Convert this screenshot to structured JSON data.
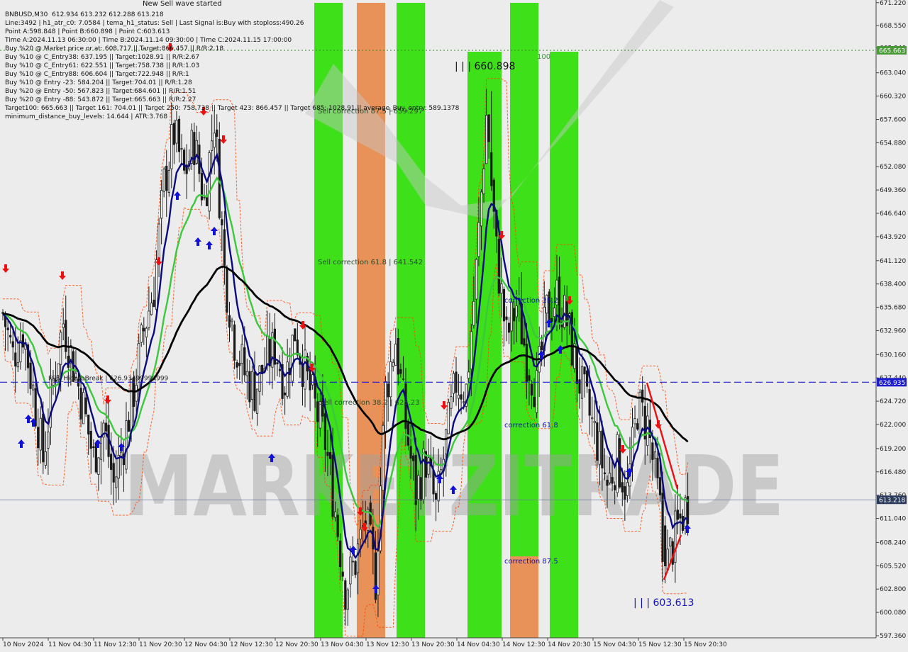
{
  "header": {
    "signal_line": "New Sell wave started",
    "lines": [
      "BNBUSD,M30  612.934 613.232 612.288 613.218",
      "Line:3492 | h1_atr_c0: 7.0584 | tema_h1_status: Sell | Last Signal is:Buy with stoploss:490.26",
      "Point A:598.848 | Point B:660.898 | Point C:603.613",
      "Time A:2024.11.13 06:30:00 | Time B:2024.11.14 09:30:00 | Time C:2024.11.15 17:00:00",
      "Buy %20 @ Market price or at: 608.717 || Target:866.457 || R/R:2.18",
      "Buy %10 @ C_Entry38: 637.195 || Target:1028.91 || R/R:2.67",
      "Buy %10 @ C_Entry61: 622.551 || Target:758.738 || R/R:1.03",
      "Buy %10 @ C_Entry88: 606.604 || Target:722.948 || R/R:1",
      "Buy %10 @ Entry -23: 584.204 || Target:704.01 || R/R:1.28",
      "Buy %20 @ Entry -50: 567.823 || Target:684.601 || R/R:1.51",
      "Buy %20 @ Entry -88: 543.872 || Target:665.663 || R/R:2.27",
      "Target100: 665.663 || Target 161: 704.01 || Target 250: 758.738 || Target 423: 866.457 || Target 685: 1028.91 || average_Buy_entry: 589.1378",
      "minimum_distance_buy_levels: 14.644 | ATR:3.768"
    ]
  },
  "annotations": {
    "point_b": "| | | 660.898",
    "point_c": "| | | 603.613",
    "sell_corr_875": "Sell correction 87.5 | 659.297",
    "sell_corr_618": "Sell correction 61.8 | 641.542",
    "sell_corr_382": "Sell correction 38.2 | 625.23",
    "corr_382": "correction 38.2",
    "corr_618": "correction 61.8",
    "corr_875": "correction 87.5",
    "level_100": "100",
    "fsb_label": "FSB_HighToBreak | 626.93499999999",
    "watermark": "MARKETZITRADE"
  },
  "colors": {
    "background": "#ececec",
    "bull_candle": "#1a1a1a",
    "bear_candle": "#1a1a1a",
    "green_zone": "#3ee01a",
    "orange_zone": "#e8925a",
    "ma_dark_blue": "#0a0a80",
    "ma_green": "#3cc83c",
    "ma_black": "#000000",
    "fsb_line": "#1c1ccc",
    "price_tag": "#2a3a5a",
    "target_tag": "#4a9a3a",
    "buy_arrow": "#1010dd",
    "sell_arrow": "#ee1010",
    "orange_dash": "#ff4400"
  },
  "chart_data": {
    "type": "candlestick",
    "symbol": "BNBUSD",
    "timeframe": "M30",
    "ylim": [
      597.36,
      671.2
    ],
    "y_ticks": [
      "671.220",
      "668.550",
      "665.940",
      "663.040",
      "660.320",
      "657.600",
      "654.880",
      "652.080",
      "649.360",
      "646.640",
      "643.920",
      "641.120",
      "638.400",
      "635.680",
      "632.960",
      "630.160",
      "627.440",
      "624.720",
      "622.000",
      "619.200",
      "616.480",
      "613.760",
      "611.040",
      "608.240",
      "605.520",
      "602.800",
      "600.080",
      "597.360"
    ],
    "x_labels": [
      "10 Nov 2024",
      "11 Nov 04:30",
      "11 Nov 12:30",
      "11 Nov 20:30",
      "12 Nov 04:30",
      "12 Nov 12:30",
      "12 Nov 20:30",
      "13 Nov 04:30",
      "13 Nov 12:30",
      "13 Nov 20:30",
      "14 Nov 04:30",
      "14 Nov 12:30",
      "14 Nov 20:30",
      "15 Nov 04:30",
      "15 Nov 12:30",
      "15 Nov 20:30"
    ],
    "current_price": 613.218,
    "current_price_label": "613.218",
    "fsb_high_to_break": 626.935,
    "fsb_label": "626.935",
    "target_100": 665.663,
    "target_label": "665.663",
    "point_b": 660.898,
    "point_c": 603.613,
    "close_anchors": [
      [
        0,
        635
      ],
      [
        4,
        630
      ],
      [
        8,
        633
      ],
      [
        12,
        626
      ],
      [
        16,
        618
      ],
      [
        20,
        627
      ],
      [
        24,
        634
      ],
      [
        28,
        629
      ],
      [
        32,
        624
      ],
      [
        36,
        618
      ],
      [
        40,
        622
      ],
      [
        44,
        615
      ],
      [
        48,
        620
      ],
      [
        52,
        626
      ],
      [
        56,
        633
      ],
      [
        60,
        638
      ],
      [
        64,
        650
      ],
      [
        68,
        656
      ],
      [
        72,
        651
      ],
      [
        76,
        655
      ],
      [
        80,
        648
      ],
      [
        84,
        658
      ],
      [
        88,
        640
      ],
      [
        92,
        632
      ],
      [
        96,
        628
      ],
      [
        100,
        626
      ],
      [
        104,
        629
      ],
      [
        108,
        631
      ],
      [
        112,
        627
      ],
      [
        116,
        633
      ],
      [
        120,
        628
      ],
      [
        124,
        624
      ],
      [
        128,
        620
      ],
      [
        132,
        612
      ],
      [
        136,
        603
      ],
      [
        140,
        606
      ],
      [
        144,
        611
      ],
      [
        148,
        604
      ],
      [
        152,
        626
      ],
      [
        156,
        632
      ],
      [
        160,
        622
      ],
      [
        164,
        614
      ],
      [
        168,
        618
      ],
      [
        172,
        612
      ],
      [
        176,
        620
      ],
      [
        180,
        627
      ],
      [
        184,
        626
      ],
      [
        188,
        640
      ],
      [
        192,
        658
      ],
      [
        196,
        642
      ],
      [
        200,
        632
      ],
      [
        204,
        636
      ],
      [
        208,
        630
      ],
      [
        212,
        626
      ],
      [
        216,
        635
      ],
      [
        220,
        637
      ],
      [
        224,
        634
      ],
      [
        228,
        628
      ],
      [
        232,
        624
      ],
      [
        236,
        620
      ],
      [
        240,
        615
      ],
      [
        244,
        618
      ],
      [
        248,
        614
      ],
      [
        252,
        624
      ],
      [
        256,
        622
      ],
      [
        260,
        614
      ],
      [
        264,
        606
      ],
      [
        268,
        610
      ],
      [
        272,
        613
      ]
    ]
  }
}
